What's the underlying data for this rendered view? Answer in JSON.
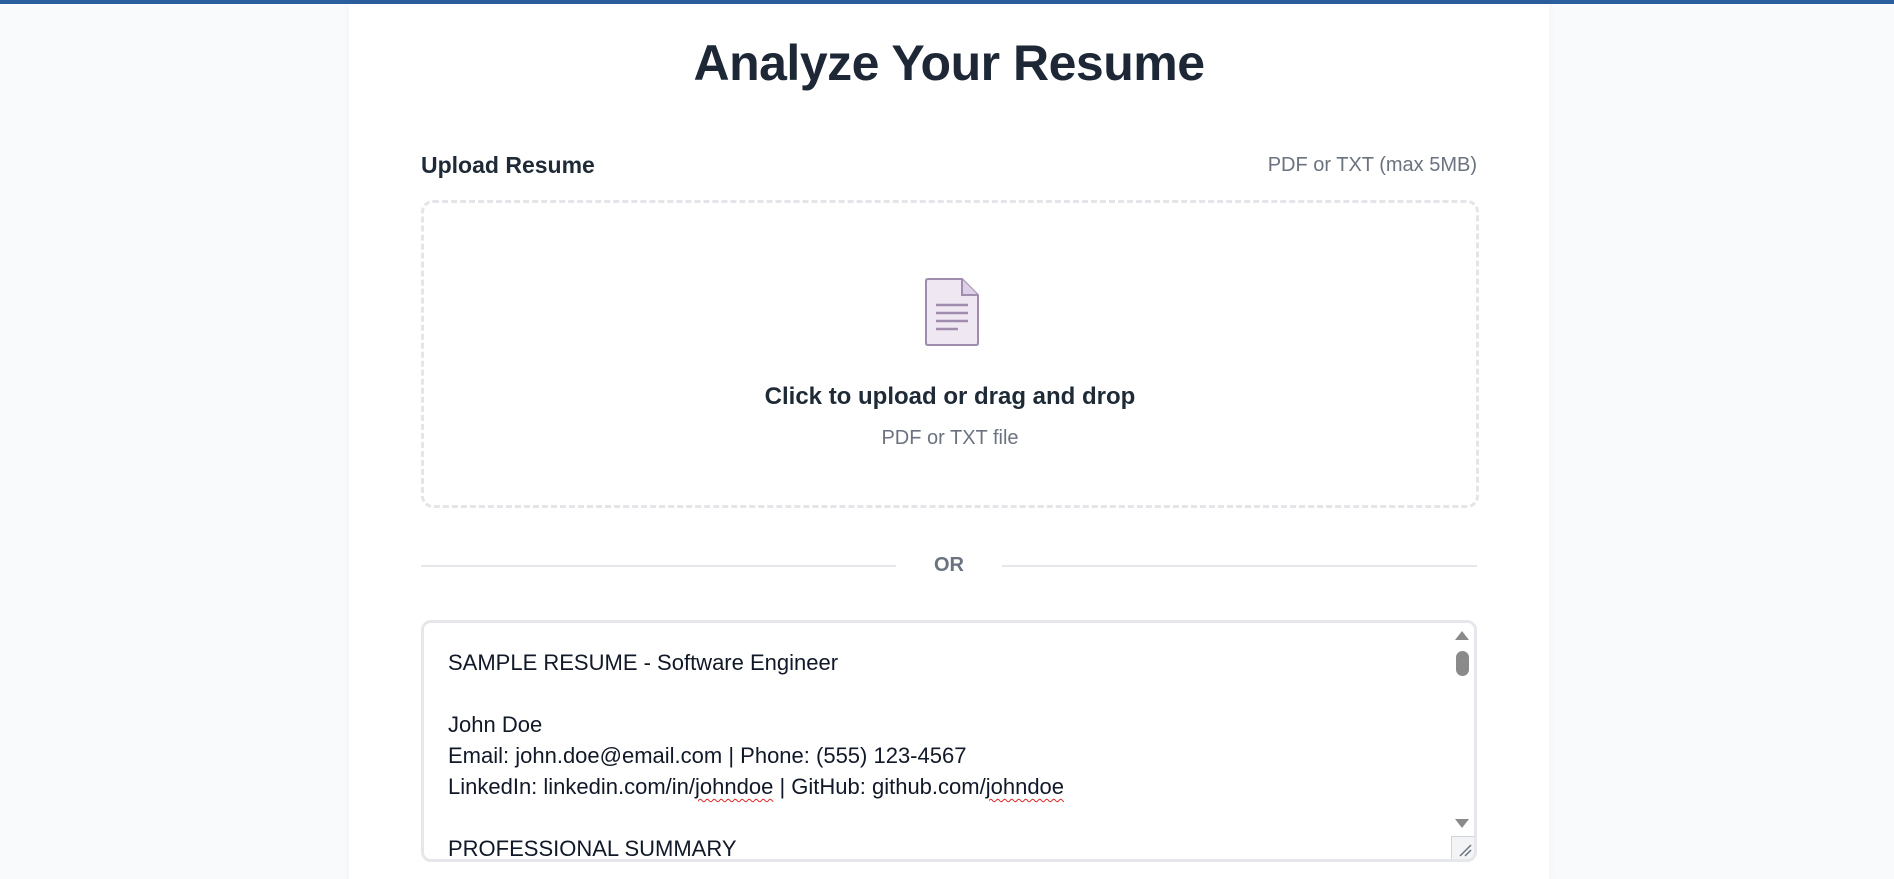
{
  "page": {
    "title": "Analyze Your Resume"
  },
  "upload": {
    "label": "Upload Resume",
    "hint": "PDF or TXT (max 5MB)",
    "dropzone_title": "Click to upload or drag and drop",
    "dropzone_subtitle": "PDF or TXT file",
    "icon": "document-icon"
  },
  "divider": {
    "label": "OR"
  },
  "resume_text": {
    "lines": [
      "SAMPLE RESUME - Software Engineer",
      "",
      "John Doe",
      "Email: john.doe@email.com | Phone: (555) 123-4567",
      "LinkedIn: linkedin.com/in/johndoe | GitHub: github.com/johndoe",
      "",
      "PROFESSIONAL SUMMARY"
    ]
  },
  "colors": {
    "accent_bar": "#2b5e9e",
    "title": "#1d2736",
    "muted": "#6b7280",
    "border": "#e5e7eb",
    "icon_fill": "#efe8f3",
    "icon_stroke": "#a08cae"
  }
}
